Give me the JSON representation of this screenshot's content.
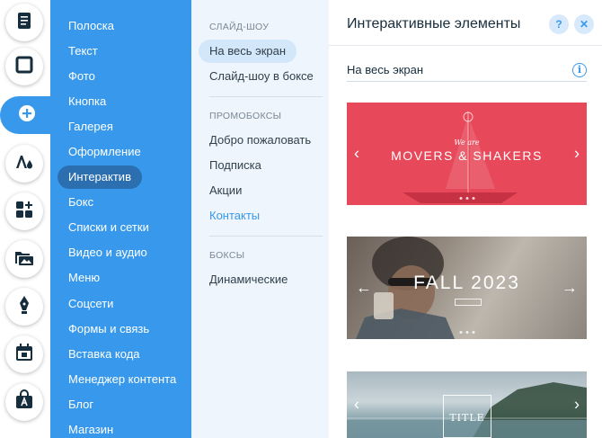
{
  "rail": {
    "items": [
      {
        "name": "page-icon",
        "active": false
      },
      {
        "name": "background-icon",
        "active": false
      },
      {
        "name": "add-icon",
        "active": true
      },
      {
        "name": "theme-icon",
        "active": false
      },
      {
        "name": "apps-icon",
        "active": false
      },
      {
        "name": "media-icon",
        "active": false
      },
      {
        "name": "pen-icon",
        "active": false
      },
      {
        "name": "calendar-icon",
        "active": false
      },
      {
        "name": "store-icon",
        "active": false
      }
    ],
    "accent": "#3899ec"
  },
  "categories": {
    "items": [
      "Полоска",
      "Текст",
      "Фото",
      "Кнопка",
      "Галерея",
      "Оформление",
      "Интерактив",
      "Бокс",
      "Списки и сетки",
      "Видео и аудио",
      "Меню",
      "Соцсети",
      "Формы и связь",
      "Вставка кода",
      "Менеджер контента",
      "Блог",
      "Магазин"
    ],
    "selected": "Интерактив"
  },
  "subcategories": {
    "section1_title": "СЛАЙД-ШОУ",
    "section1": [
      "На весь экран",
      "Слайд-шоу в боксе"
    ],
    "section2_title": "ПРОМОБОКСЫ",
    "section2": [
      "Добро пожаловать",
      "Подписка",
      "Акции",
      "Контакты"
    ],
    "section3_title": "БОКСЫ",
    "section3": [
      "Динамические"
    ]
  },
  "panel": {
    "title": "Интерактивные элементы",
    "help_label": "?",
    "close_label": "✕",
    "subheader": "На весь экран",
    "info_label": "i"
  },
  "templates": {
    "movers": {
      "pre": "We are",
      "title": "MOVERS & SHAKERS"
    },
    "fall": {
      "title": "FALL 2023"
    },
    "title_slide": {
      "title": "TITLE"
    }
  },
  "arrows": {
    "prev": "‹",
    "next": "›",
    "prev_long": "←",
    "next_long": "→"
  }
}
